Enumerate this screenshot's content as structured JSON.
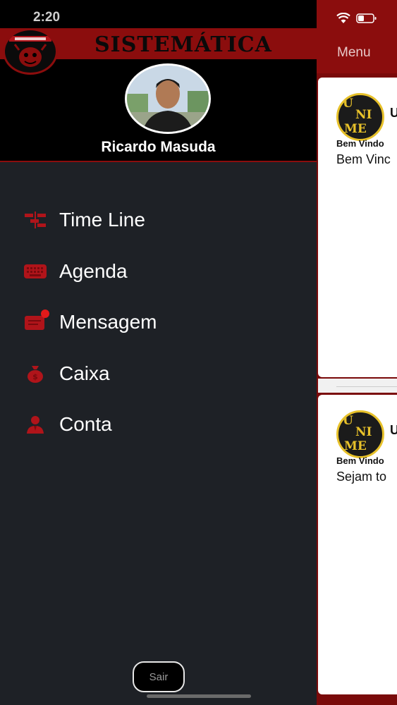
{
  "status_bar": {
    "time": "2:20"
  },
  "drawer": {
    "banner_title": "SISTEMÁTICA",
    "user_name": "Ricardo Masuda",
    "nav_items": [
      {
        "label": "Time Line",
        "icon": "timeline-icon"
      },
      {
        "label": "Agenda",
        "icon": "keyboard-icon"
      },
      {
        "label": "Mensagem",
        "icon": "message-icon",
        "has_badge": true
      },
      {
        "label": "Caixa",
        "icon": "money-bag-icon"
      },
      {
        "label": "Conta",
        "icon": "account-icon"
      }
    ],
    "logout_label": "Sair"
  },
  "main": {
    "menu_label": "Menu",
    "posts": [
      {
        "title": "U",
        "subtitle": "Bem Vindo",
        "body": "Bem Vinc"
      },
      {
        "title": "U",
        "subtitle": "Bem Vindo",
        "body": "Sejam to"
      }
    ]
  },
  "colors": {
    "accent": "#8b0d0d",
    "drawer_bg": "#1e2126",
    "icon_red": "#b0141a",
    "badge": "#e31a1a",
    "logo_gold": "#e7c12a"
  }
}
